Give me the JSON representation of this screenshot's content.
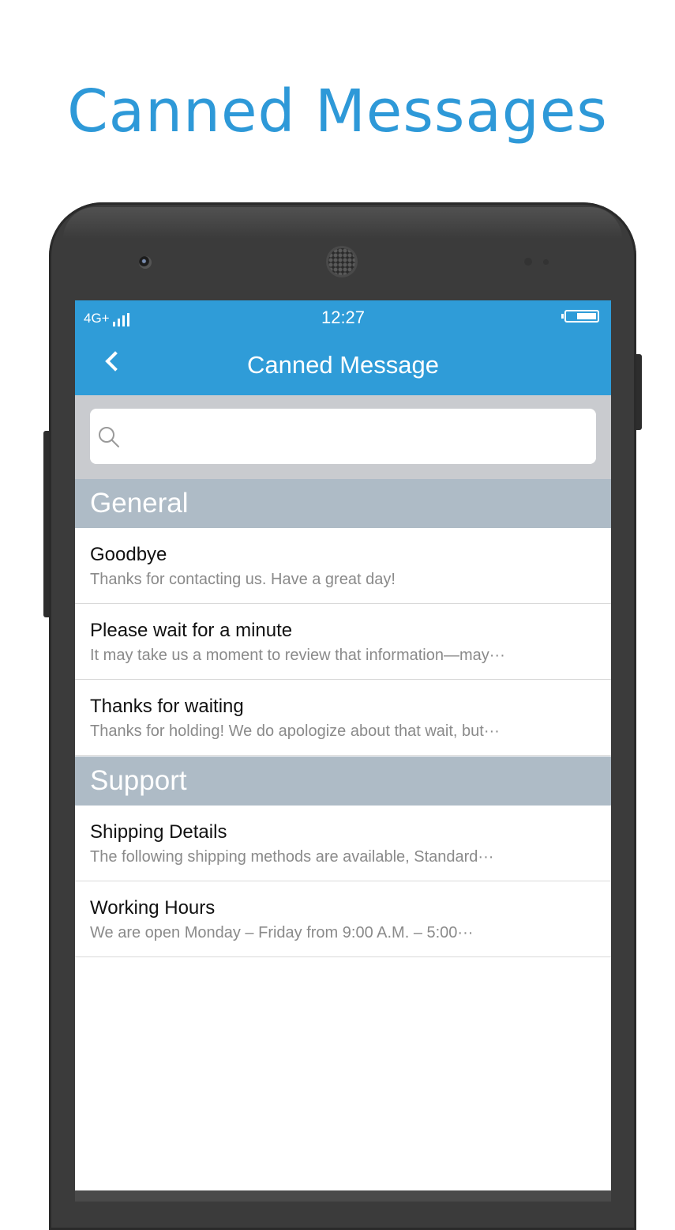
{
  "promo": {
    "title": "Canned Messages"
  },
  "status_bar": {
    "network": "4G+",
    "time": "12:27"
  },
  "nav": {
    "title": "Canned Message"
  },
  "search": {
    "placeholder": ""
  },
  "sections": [
    {
      "title": "General",
      "items": [
        {
          "title": "Goodbye",
          "body": "Thanks for contacting us. Have a great day!"
        },
        {
          "title": "Please wait for a minute",
          "body": "It may take us a moment to review that information—may···"
        },
        {
          "title": "Thanks for waiting",
          "body": "Thanks for holding! We do apologize about that wait, but···"
        }
      ]
    },
    {
      "title": "Support",
      "items": [
        {
          "title": "Shipping Details",
          "body": "The following shipping methods are available, Standard···"
        },
        {
          "title": "Working Hours",
          "body": "We are open Monday  –  Friday from 9:00 A.M.  –  5:00···"
        }
      ]
    }
  ],
  "colors": {
    "accent": "#2f9cd8",
    "section_header": "#aebbc6",
    "search_bg": "#c9cbcf"
  },
  "icons": {
    "back": "chevron-left-icon",
    "search": "search-icon",
    "battery": "battery-icon",
    "signal": "signal-icon"
  }
}
